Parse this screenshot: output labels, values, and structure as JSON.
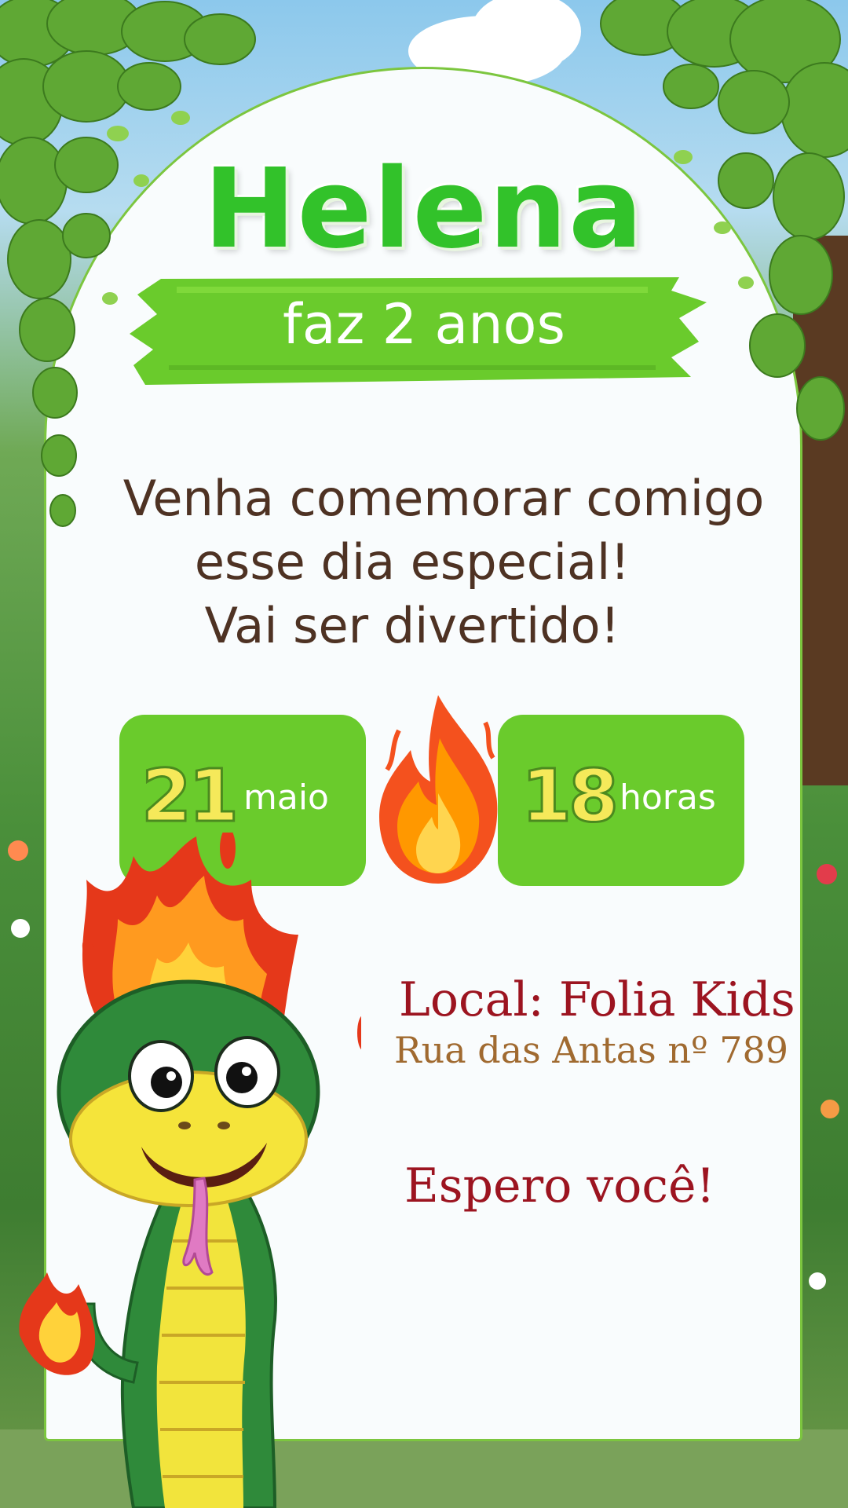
{
  "invite": {
    "name": "Helena",
    "subtitle": "faz 2 anos",
    "message_lines": [
      "Venha comemorar comigo",
      "esse dia especial!",
      "Vai ser divertido!"
    ],
    "date": {
      "day": "21",
      "month": "maio"
    },
    "time": {
      "hour": "18",
      "unit": "horas"
    },
    "location_title": "Local: Folia Kids",
    "address": "Rua das Antas nº 789",
    "closing": "Espero você!"
  },
  "colors": {
    "title_green": "#32c22a",
    "box_green": "#6acb2c",
    "number_yellow": "#f5e95a",
    "message_brown": "#4e3223",
    "location_red": "#9c1420",
    "address_brown": "#a06a30"
  },
  "decorations": [
    "ivy-vines",
    "forest-background",
    "fire-icon",
    "fire-snake-mascot"
  ]
}
